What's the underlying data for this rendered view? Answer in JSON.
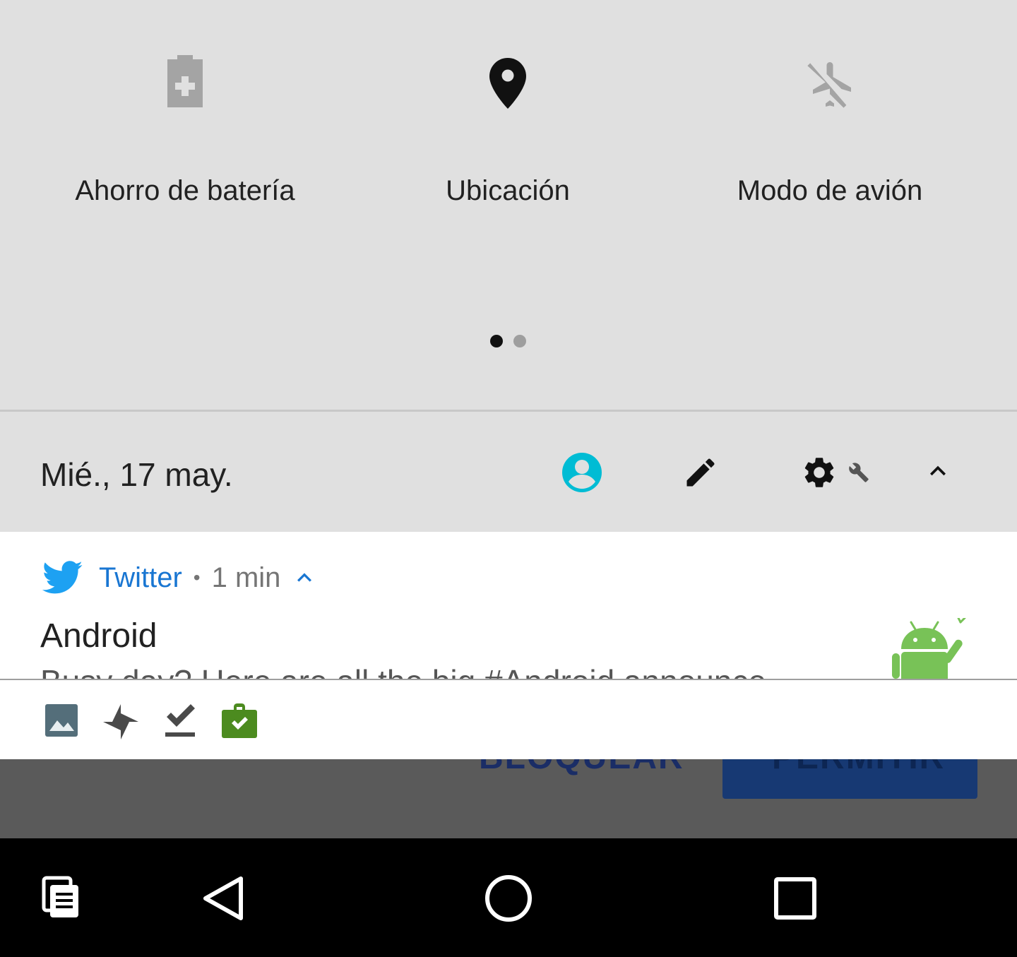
{
  "quick_settings": {
    "tiles": [
      {
        "label": "Ahorro de batería",
        "icon": "battery-saver-icon",
        "state": "off"
      },
      {
        "label": "Ubicación",
        "icon": "location-pin-icon",
        "state": "on"
      },
      {
        "label": "Modo de avión",
        "icon": "airplane-mode-off-icon",
        "state": "off"
      }
    ],
    "page_count": 2,
    "active_page": 1
  },
  "header": {
    "date": "Mié., 17 may.",
    "icons": [
      "user-account-icon",
      "edit-pencil-icon",
      "settings-gear-icon",
      "wrench-icon",
      "collapse-chevron-icon"
    ]
  },
  "notification": {
    "app": "Twitter",
    "separator": "•",
    "time": "1 min",
    "title": "Android",
    "body": "Busy day? Here are all the big #Android announce"
  },
  "notification_shelf": {
    "icons": [
      "image-icon",
      "pinwheel-icon",
      "download-done-icon",
      "work-briefcase-icon"
    ]
  },
  "background_dialog": {
    "block_label": "BLOQUEAR",
    "allow_label": "PERMITIR"
  },
  "navigation_bar": {
    "icons": [
      "recents-docs-icon",
      "back-icon",
      "home-icon",
      "overview-icon"
    ]
  },
  "colors": {
    "panel_bg": "#e0e0e0",
    "twitter_blue": "#1da1f2",
    "app_name_blue": "#1976d2",
    "account_cyan": "#00bcd4",
    "android_green": "#78c257",
    "work_green": "#4c8b1f"
  }
}
